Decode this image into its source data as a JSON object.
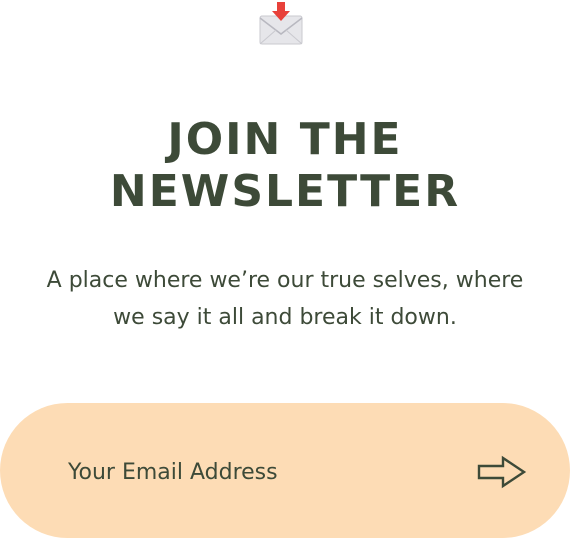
{
  "newsletter": {
    "icon": "incoming-envelope-icon",
    "title_lines": [
      "JOIN THE",
      "NEWSLETTER"
    ],
    "subtitle_lines": [
      "A place where we’re our true selves, where",
      "we say it all and break it down."
    ],
    "email_placeholder": "Your Email Address",
    "submit_icon": "arrow-right-icon"
  },
  "colors": {
    "text": "#3d4a38",
    "form_background": "#fddcb5",
    "icon_arrow": "#e8413a"
  }
}
